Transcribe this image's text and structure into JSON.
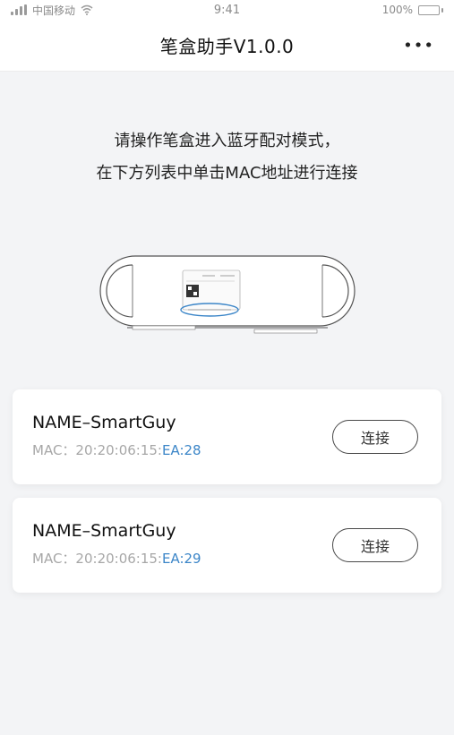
{
  "status_bar": {
    "carrier": "中国移动",
    "time": "9:41",
    "battery": "100%"
  },
  "nav": {
    "title": "笔盒助手V1.0.0",
    "more_label": "•••"
  },
  "instructions": {
    "line1": "请操作笔盒进入蓝牙配对模式，",
    "line2": "在下方列表中单击MAC地址进行连接"
  },
  "devices": [
    {
      "name": "NAME–SmartGuy",
      "mac_prefix": "MAC：",
      "mac_main": "20:20:06:15:",
      "mac_tail": "EA:28",
      "connect_label": "连接"
    },
    {
      "name": "NAME–SmartGuy",
      "mac_prefix": "MAC：",
      "mac_main": "20:20:06:15:",
      "mac_tail": "EA:29",
      "connect_label": "连接"
    }
  ],
  "colors": {
    "accent_mac": "#3c86c8",
    "background": "#f3f4f6",
    "card": "#ffffff"
  }
}
